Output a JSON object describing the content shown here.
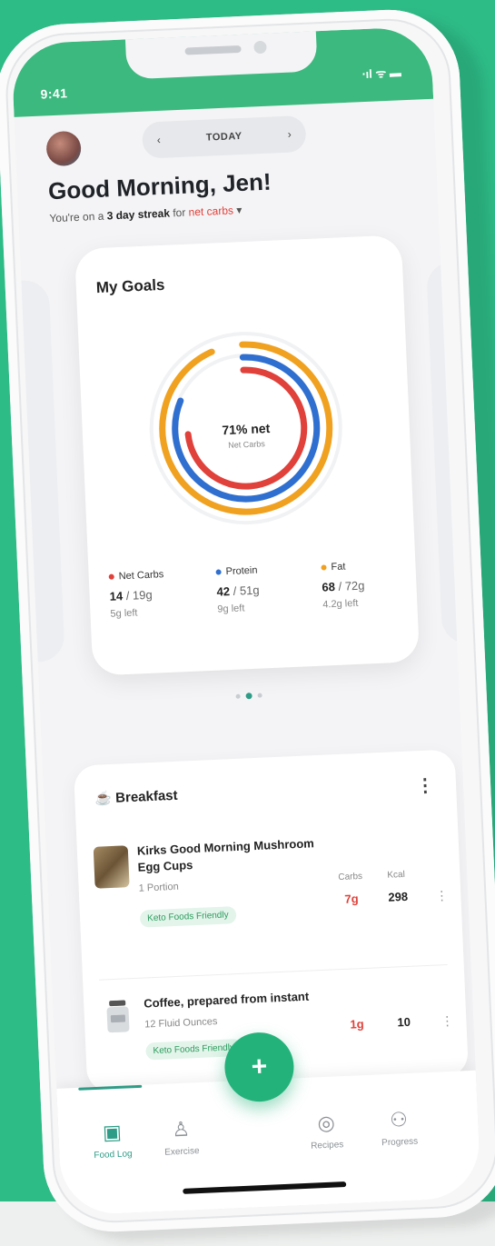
{
  "status_bar": {
    "time": "9:41",
    "icons": "⋅ıl ᯤ ▬"
  },
  "header": {
    "prev_arrow": "‹",
    "date_label": "TODAY",
    "next_arrow": "›",
    "greeting": "Good Morning, Jen!",
    "streak_prefix": "You're on a ",
    "streak_days": "3 day streak",
    "streak_mid": " for ",
    "streak_goal": "net carbs",
    "streak_suffix": " ▾"
  },
  "goals": {
    "title": "My Goals",
    "center_value": "71% net",
    "center_sub": "Net Carbs",
    "macros": [
      {
        "name": "Net Carbs",
        "value": "14",
        "target": "/ 19g",
        "left": "5g left",
        "color": "#e0413a",
        "progress": 0.74
      },
      {
        "name": "Protein",
        "value": "42",
        "target": "/ 51g",
        "left": "9g left",
        "color": "#2f6fd0",
        "progress": 0.82
      },
      {
        "name": "Fat",
        "value": "68",
        "target": "/ 72g",
        "left": "4.2g left",
        "color": "#f0a11f",
        "progress": 0.94
      }
    ]
  },
  "pager": {
    "pages": 3,
    "active": 1
  },
  "meal": {
    "title": "Breakfast",
    "header_icon": "☕",
    "more": "⋮",
    "columns": {
      "carbs": "Carbs",
      "kcal": "Kcal"
    },
    "items": [
      {
        "name": "Kirks Good Morning Mushroom Egg Cups",
        "qty": "1 Portion",
        "tag": "Keto Foods Friendly",
        "carbs": "7g",
        "kcal": "298"
      },
      {
        "name": "Coffee, prepared from instant",
        "qty": "12 Fluid Ounces",
        "tag": "Keto Foods Friendly",
        "carbs": "1g",
        "kcal": "10"
      }
    ]
  },
  "tabbar": {
    "tabs": [
      {
        "label": "Food Log",
        "icon": "▣"
      },
      {
        "label": "Exercise",
        "icon": "♙"
      },
      {
        "label": "Recipes",
        "icon": "◎"
      },
      {
        "label": "Progress",
        "icon": "⚇"
      }
    ],
    "fab": "+"
  }
}
